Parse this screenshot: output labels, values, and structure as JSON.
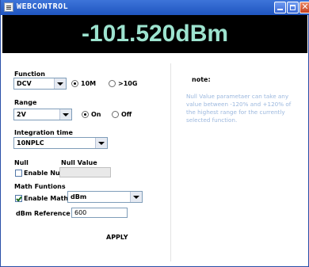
{
  "window": {
    "title": "WEBCONTROL",
    "close_glyph": "✕"
  },
  "display": {
    "reading": "-101.520dBm"
  },
  "function": {
    "label": "Function",
    "selected": "DCV",
    "radio_10m": "10M",
    "radio_10g": ">10G",
    "impedance_selected": "10M"
  },
  "range": {
    "label": "Range",
    "selected": "2V",
    "radio_on": "On",
    "radio_off": "Off",
    "auto_selected": "On"
  },
  "integration": {
    "label": "Integration time",
    "selected": "10NPLC"
  },
  "null": {
    "label": "Null",
    "value_label": "Null Value",
    "enable_label": "Enable Null",
    "enabled": false,
    "value": ""
  },
  "math": {
    "label": "Math Funtions",
    "enable_label": "Enable Math",
    "enabled": true,
    "selected": "dBm",
    "ref_label": "dBm Reference",
    "ref_value": "600"
  },
  "apply_label": "APPLY",
  "note": {
    "title": "note:",
    "text": "Null Value parametaer can take any value between -120% and +120% of the highest range for the currently selected function."
  }
}
